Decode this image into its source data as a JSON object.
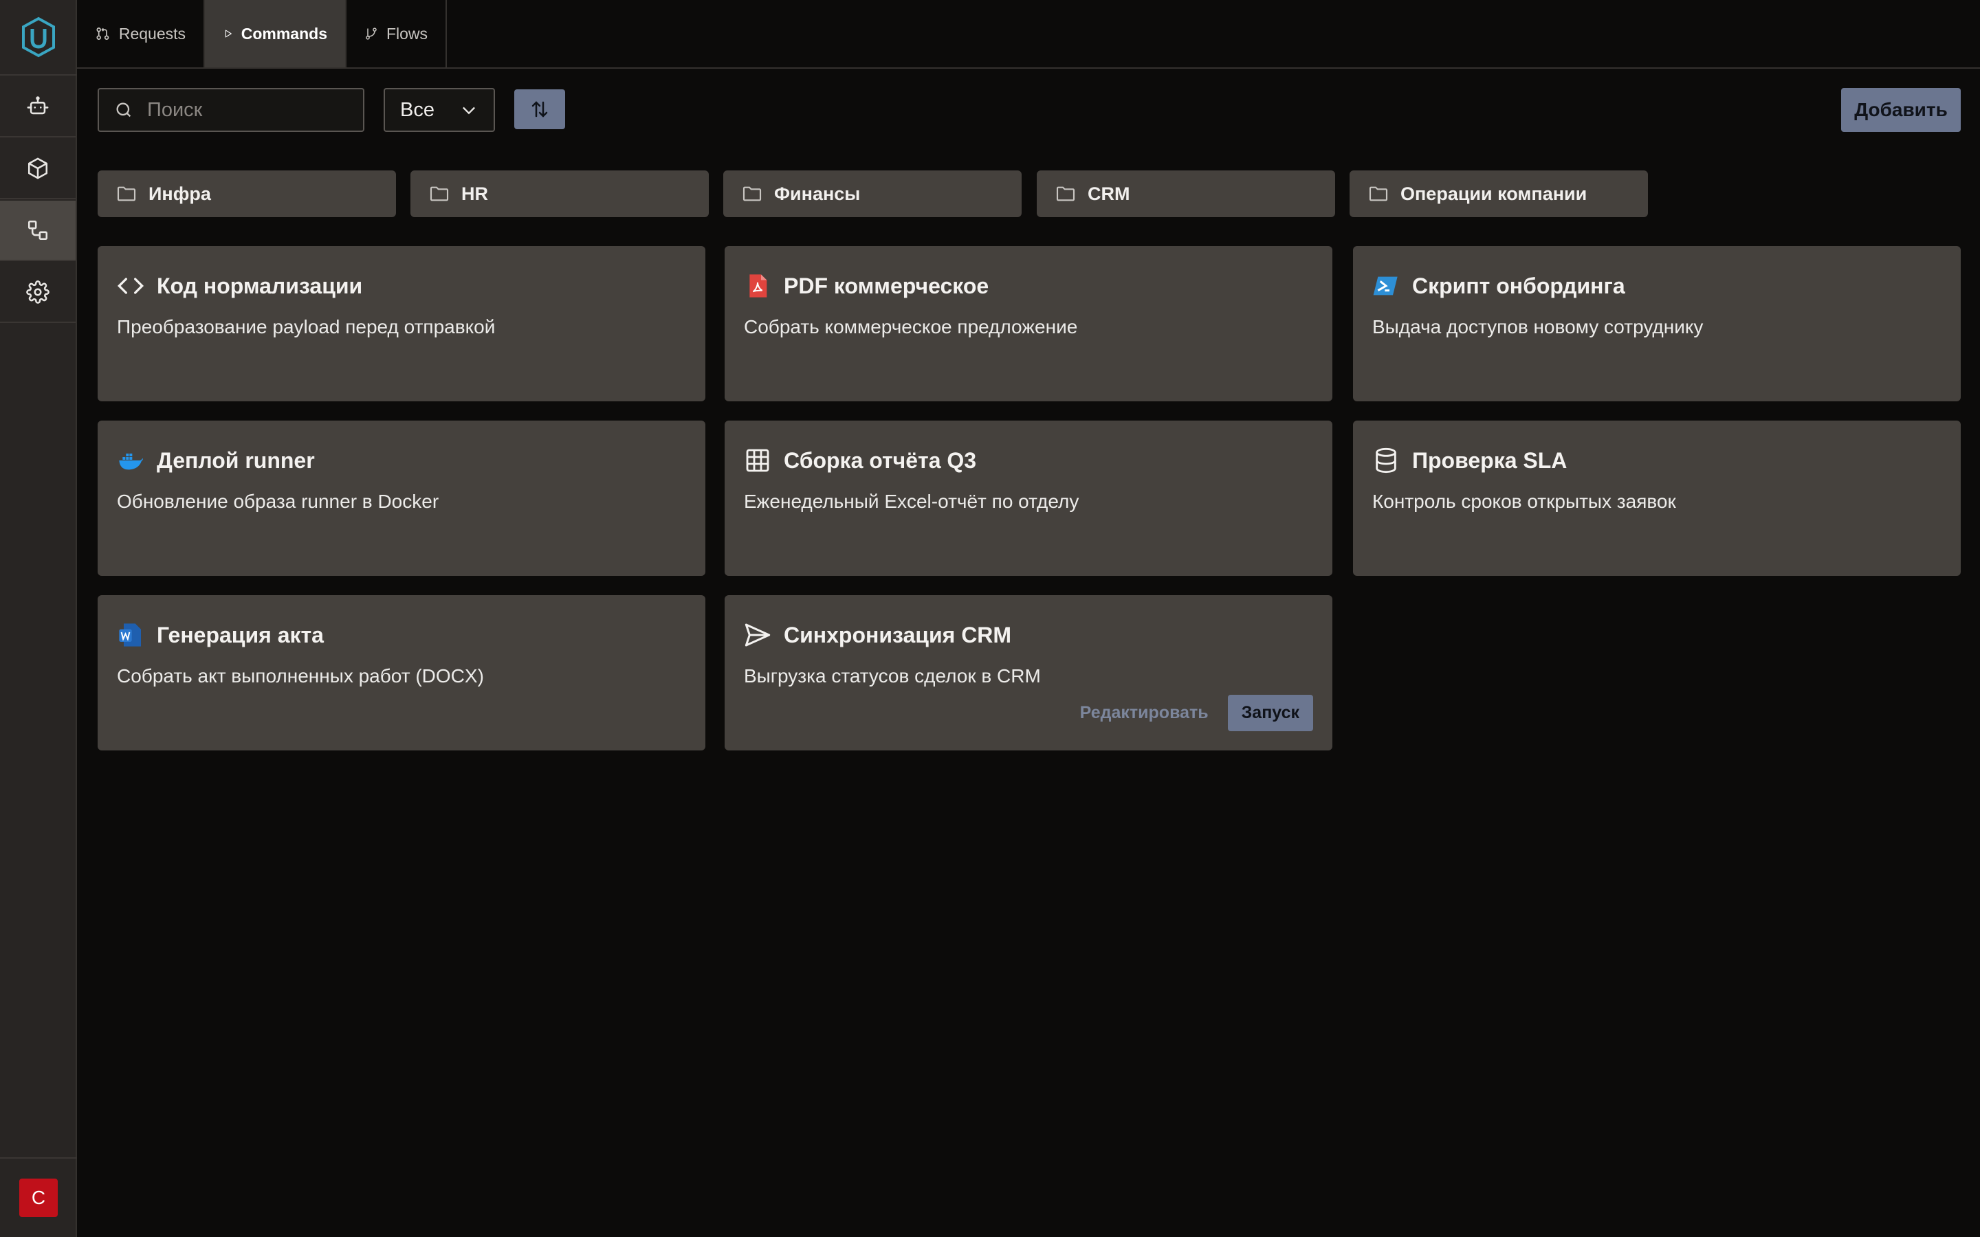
{
  "sidebar": {
    "logo_icon": "u-shield-logo-icon",
    "items": [
      {
        "icon": "robot-icon",
        "active": false
      },
      {
        "icon": "cube-icon",
        "active": false
      },
      {
        "icon": "flow-nodes-icon",
        "active": true
      },
      {
        "icon": "gear-icon",
        "active": false
      }
    ],
    "avatar_letter": "C",
    "avatar_color": "#c0101a"
  },
  "tabs": [
    {
      "label": "Requests",
      "icon": "git-pull-request-icon",
      "active": false
    },
    {
      "label": "Commands",
      "icon": "play-icon",
      "active": true
    },
    {
      "label": "Flows",
      "icon": "git-branch-icon",
      "active": false
    }
  ],
  "toolbar": {
    "search_placeholder": "Поиск",
    "search_value": "",
    "filter_value": "Все",
    "add_label": "Добавить"
  },
  "folders": [
    {
      "label": "Инфра"
    },
    {
      "label": "HR"
    },
    {
      "label": "Финансы"
    },
    {
      "label": "CRM"
    },
    {
      "label": "Операции компании"
    }
  ],
  "commands": [
    {
      "title": "Код нормализации",
      "description": "Преобразование payload перед отправкой",
      "icon": "code-icon"
    },
    {
      "title": "PDF коммерческое",
      "description": "Собрать коммерческое предложение",
      "icon": "pdf-file-icon"
    },
    {
      "title": "Скрипт онбординга",
      "description": "Выдача доступов новому сотруднику",
      "icon": "powershell-icon"
    },
    {
      "title": "Деплой runner",
      "description": "Обновление образа runner в Docker",
      "icon": "docker-icon"
    },
    {
      "title": "Сборка отчёта Q3",
      "description": "Еженедельный Excel-отчёт по отделу",
      "icon": "table-icon"
    },
    {
      "title": "Проверка SLA",
      "description": "Контроль сроков открытых заявок",
      "icon": "database-icon"
    },
    {
      "title": "Генерация акта",
      "description": "Собрать акт выполненных работ (DOCX)",
      "icon": "word-file-icon"
    },
    {
      "title": "Синхронизация CRM",
      "description": "Выгрузка статусов сделок в CRM",
      "icon": "send-icon"
    }
  ],
  "hover_card": {
    "edit_label": "Редактировать",
    "run_label": "Запуск"
  },
  "colors": {
    "accent": "#6b7690",
    "card_bg": "#45413d",
    "page_bg": "#0c0b0a",
    "sidebar_bg": "#282523",
    "logo": "#3aa6c2"
  }
}
